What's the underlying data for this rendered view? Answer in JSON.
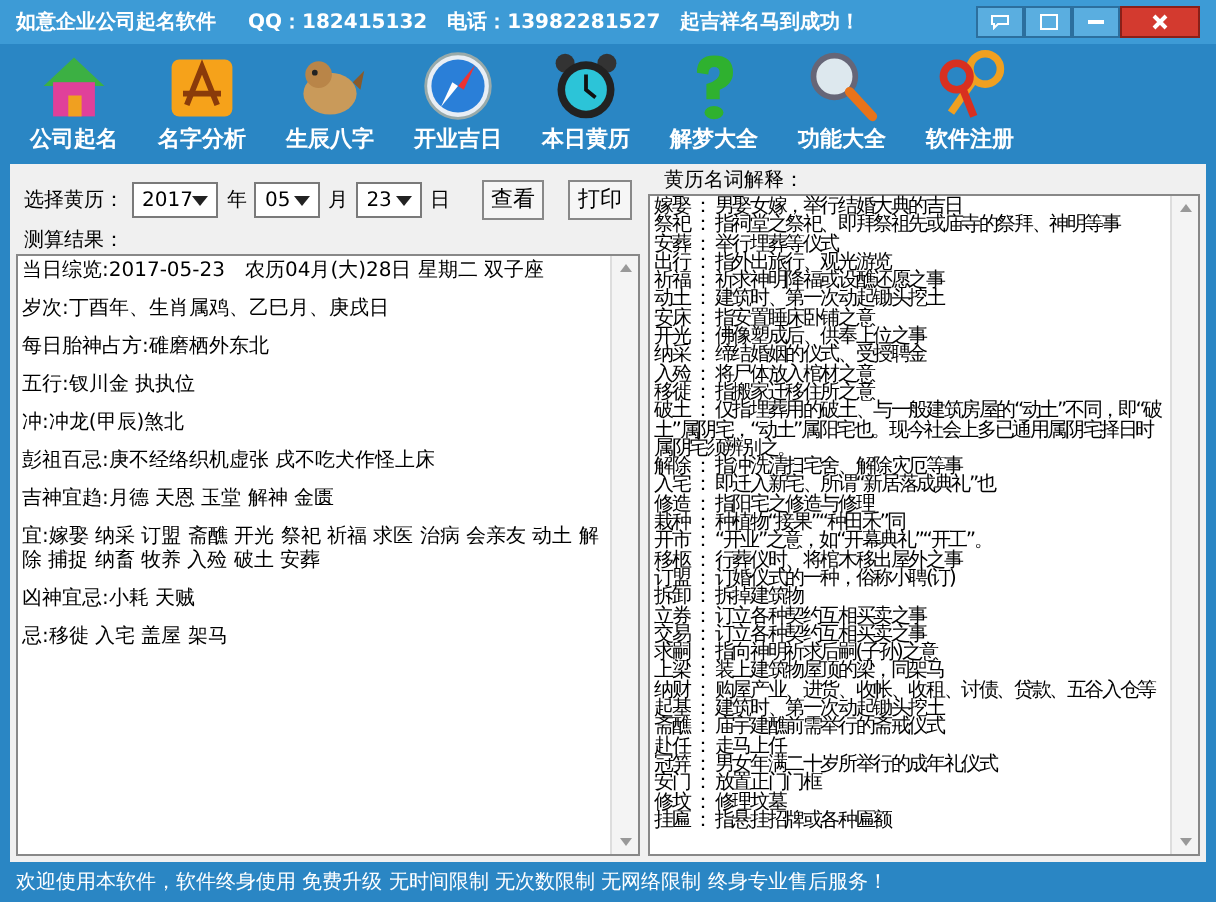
{
  "window": {
    "title": "如意企业公司起名软件",
    "contact": "QQ：182415132　电话：13982281527　起吉祥名马到成功！"
  },
  "toolbar": [
    {
      "label": "公司起名"
    },
    {
      "label": "名字分析"
    },
    {
      "label": "生辰八字"
    },
    {
      "label": "开业吉日"
    },
    {
      "label": "本日黄历"
    },
    {
      "label": "解梦大全"
    },
    {
      "label": "功能大全"
    },
    {
      "label": "软件注册"
    }
  ],
  "date_picker": {
    "label": "选择黄历：",
    "year": "2017",
    "year_unit": "年",
    "month": "05",
    "month_unit": "月",
    "day": "23",
    "day_unit": "日",
    "buttons": [
      "查看",
      "打印"
    ]
  },
  "results": {
    "title": "测算结果：",
    "lines": [
      "当日综览:2017-05-23　农历04月(大)28日 星期二 双子座",
      "岁次:丁酉年、生肖属鸡、乙巳月、庚戌日",
      "每日胎神占方:碓磨栖外东北",
      "五行:钗川金 执执位",
      "冲:冲龙(甲辰)煞北",
      "彭祖百忌:庚不经络织机虚张 戌不吃犬作怪上床",
      "吉神宜趋:月德 天恩 玉堂 解神 金匮",
      "宜:嫁娶 纳采 订盟 斋醮 开光 祭祀 祈福 求医 治病 会亲友 动土 解除 捕捉 纳畜 牧养 入殓 破土 安葬",
      "凶神宜忌:小耗 天贼",
      "忌:移徙 入宅 盖屋 架马"
    ]
  },
  "glossary": {
    "title": "黄历名词解释：",
    "separator": "：",
    "entries": [
      {
        "term": "嫁娶",
        "definition": "男娶女嫁，举行结婚大典的吉日"
      },
      {
        "term": "祭祀",
        "definition": "指祠堂之祭祀、即拜祭祖先或庙寺的祭拜、神明等事"
      },
      {
        "term": "安葬",
        "definition": "举行埋葬等仪式"
      },
      {
        "term": "出行",
        "definition": "指外出旅行、观光游览"
      },
      {
        "term": "祈福",
        "definition": "祈求神明降福或设醮还愿之事"
      },
      {
        "term": "动土",
        "definition": "建筑时、第一次动起锄头挖土"
      },
      {
        "term": "安床",
        "definition": "指安置睡床卧铺之意"
      },
      {
        "term": "开光",
        "definition": "佛像塑成后、供奉上位之事"
      },
      {
        "term": "纳采",
        "definition": "缔结婚姻的仪式、受授聘金"
      },
      {
        "term": "入殓",
        "definition": "将尸体放入棺材之意"
      },
      {
        "term": "移徙",
        "definition": "指搬家迁移住所之意"
      },
      {
        "term": "破土",
        "definition": "仅指埋葬用的破土、与一般建筑房屋的“动土”不同，即“破土”属阴宅，“动土”属阳宅也。现今社会上多已通用属阴宅择日时属阴宅须辨别之。"
      },
      {
        "term": "解除",
        "definition": "指冲洗清扫宅舍、解除灾厄等事"
      },
      {
        "term": "入宅",
        "definition": "即迁入新宅、所谓“新居落成典礼”也"
      },
      {
        "term": "修造",
        "definition": "指阳宅之修造与修理"
      },
      {
        "term": "栽种",
        "definition": "种植物“接果”“种田禾”同"
      },
      {
        "term": "开市",
        "definition": "“开业”之意，如“开幕典礼”“开工”。"
      },
      {
        "term": "移柩",
        "definition": "行葬仪时、将棺木移出屋外之事"
      },
      {
        "term": "订盟",
        "definition": "订婚仪式的一种，俗称小聘(订)"
      },
      {
        "term": "拆卸",
        "definition": "拆掉建筑物"
      },
      {
        "term": "立券",
        "definition": "订立各种契约互相买卖之事"
      },
      {
        "term": "交易",
        "definition": "订立各种契约互相买卖之事"
      },
      {
        "term": "求嗣",
        "definition": "指向神明祈求后嗣(子孙)之意"
      },
      {
        "term": "上梁",
        "definition": "装上建筑物屋顶的梁，同架马"
      },
      {
        "term": "纳财",
        "definition": "购屋产业、进货、收帐、收租、讨债、贷款、五谷入仓等"
      },
      {
        "term": "起基",
        "definition": "建筑时、第一次动起锄头挖土"
      },
      {
        "term": "斋醮",
        "definition": "庙宇建醮前需举行的斋戒仪式"
      },
      {
        "term": "赴任",
        "definition": "走马上任"
      },
      {
        "term": "冠笄",
        "definition": "男女年满二十岁所举行的成年礼仪式"
      },
      {
        "term": "安门",
        "definition": "放置正门门框"
      },
      {
        "term": "修坟",
        "definition": "修理坟墓"
      },
      {
        "term": "挂匾",
        "definition": "指悬挂招牌或各种匾额"
      }
    ]
  },
  "status_bar": "欢迎使用本软件，软件终身使用  免费升级  无时间限制  无次数限制  无网络限制  终身专业售后服务！"
}
